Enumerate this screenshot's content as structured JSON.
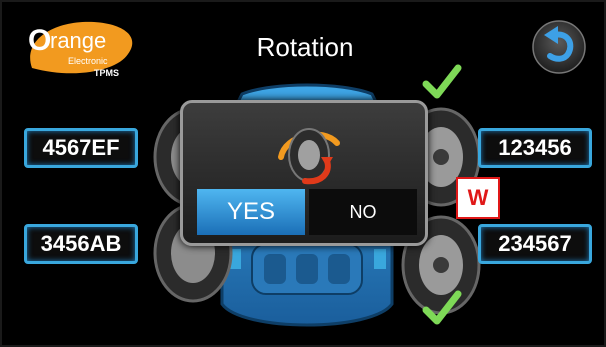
{
  "app": {
    "logo_main": "Orange",
    "logo_sub": "Electronic",
    "logo_tag": "TPMS",
    "title": "Rotation"
  },
  "sensors": {
    "front_left": "4567EF",
    "front_right": "123456",
    "rear_left": "3456AB",
    "rear_right": "234567"
  },
  "dialog": {
    "yes_label": "YES",
    "no_label": "NO"
  },
  "badge": {
    "label": "W"
  },
  "colors": {
    "accent_blue": "#39a7dd",
    "button_blue": "#2a86cf",
    "check_green": "#7ed957",
    "badge_red": "#e01818",
    "logo_orange": "#f29a1f"
  },
  "icons": {
    "back": "return-arrow-icon",
    "check": "checkmark-icon",
    "dialog": "tire-rotation-icon"
  }
}
